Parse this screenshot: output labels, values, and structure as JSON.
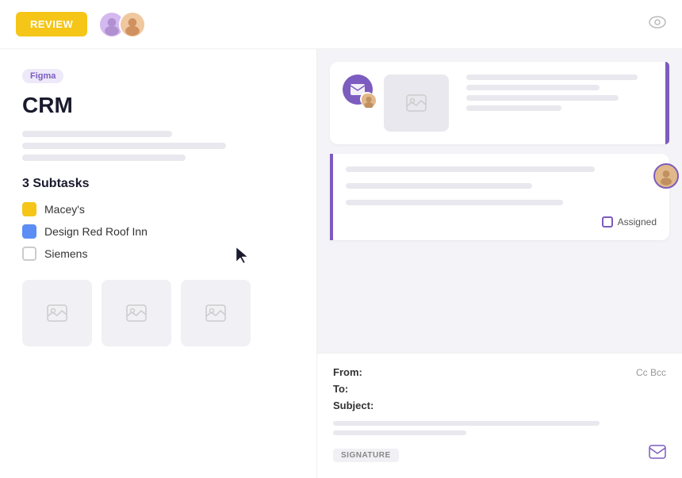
{
  "topbar": {
    "review_button": "REVIEW",
    "eye_icon": "👁"
  },
  "left_panel": {
    "badge": "Figma",
    "title": "CRM",
    "desc_lines": [
      {
        "width": "55%"
      },
      {
        "width": "75%"
      },
      {
        "width": "60%"
      }
    ],
    "subtasks_header": "3 Subtasks",
    "subtasks": [
      {
        "label": "Macey's",
        "state": "yellow"
      },
      {
        "label": "Design Red Roof Inn",
        "state": "blue"
      },
      {
        "label": "Siemens",
        "state": "gray"
      }
    ],
    "thumbnails": [
      "🖼",
      "🖼",
      "🖼"
    ]
  },
  "right_panel": {
    "email_card_1": {
      "envelope_icon": "✉",
      "content_lines": [
        {
          "width": "90%"
        },
        {
          "width": "70%"
        },
        {
          "width": "80%"
        },
        {
          "width": "50%"
        }
      ]
    },
    "email_card_2": {
      "content_lines": [
        {
          "width": "80%"
        },
        {
          "width": "60%"
        },
        {
          "width": "70%"
        }
      ],
      "assigned_label": "Assigned"
    },
    "compose": {
      "from_label": "From:",
      "to_label": "To:",
      "subject_label": "Subject:",
      "cc_label": "Cc Bcc",
      "compose_lines": [
        {
          "width": "80%"
        },
        {
          "width": "40%"
        }
      ],
      "signature_badge": "SIGNATURE",
      "send_icon": "✉"
    }
  }
}
